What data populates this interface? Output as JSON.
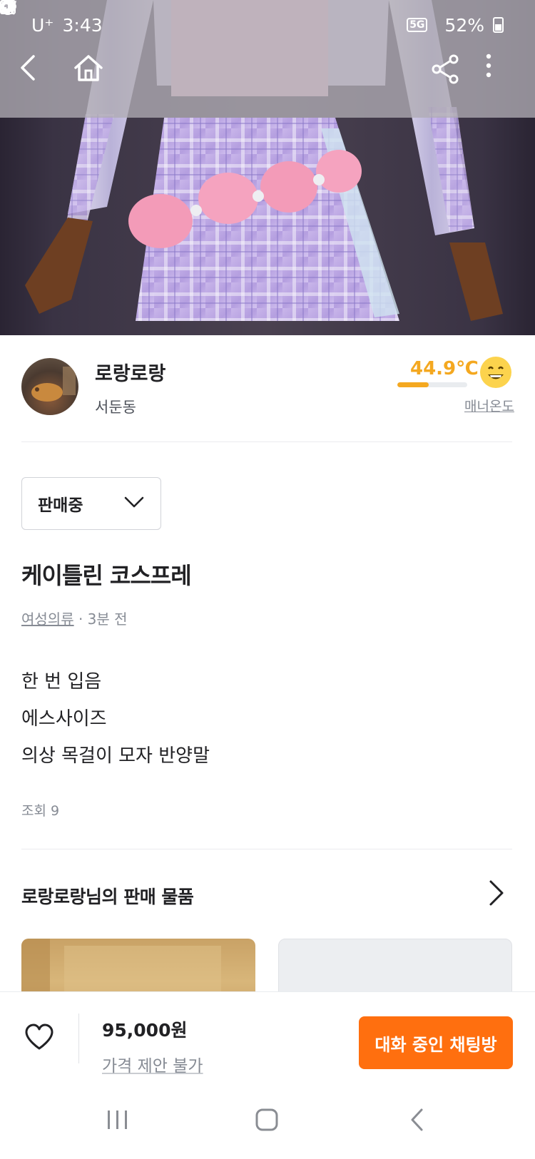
{
  "status_bar": {
    "carrier": "U⁺",
    "time": "3:43",
    "network": "5G",
    "battery": "52%"
  },
  "seller": {
    "name": "로랑로랑",
    "location": "서둔동",
    "temperature": "44.9℃",
    "temperature_level": 0.449,
    "temperature_label": "매너온도",
    "temperature_color": "#f4a820"
  },
  "product": {
    "sale_status": "판매중",
    "title": "케이틀린 코스프레",
    "category": "여성의류",
    "time_ago": "· 3분 전",
    "description": [
      "한 번 입음",
      "에스사이즈",
      "의상 목걸이 모자 반양말"
    ],
    "views": "조회 9"
  },
  "more_items": {
    "title": "로랑로랑님의 판매 물품"
  },
  "bottom_bar": {
    "price": "95,000원",
    "negotiation": "가격 제안 불가",
    "chat_button": "대화 중인 채팅방",
    "accent": "#ff6f0f"
  },
  "icons": {
    "back": "back-arrow-icon",
    "home": "home-icon",
    "share": "share-icon",
    "more": "more-vertical-icon",
    "like": "heart-icon",
    "chevron": "chevron-right-icon"
  }
}
